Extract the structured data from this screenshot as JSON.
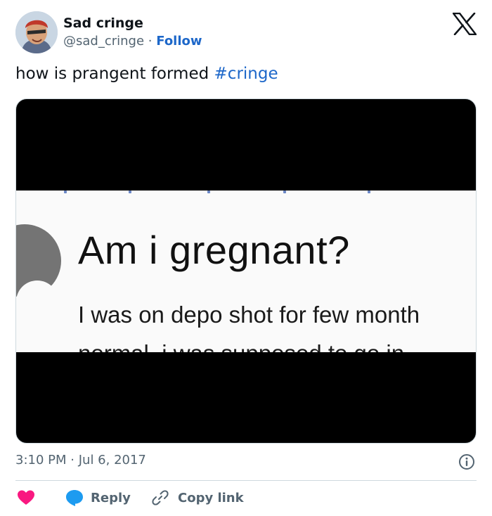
{
  "author": {
    "name": "Sad cringe",
    "handle": "@sad_cringe",
    "separator": "·",
    "follow_label": "Follow"
  },
  "tweet": {
    "text": "how is prangent formed ",
    "hashtag": "#cringe"
  },
  "media": {
    "heading": "Am i gregnant?",
    "body": "I was on depo shot for few month",
    "body_cut": "normal, i was supposed to go in"
  },
  "meta": {
    "time": "3:10 PM",
    "separator": "·",
    "date": "Jul 6, 2017"
  },
  "actions": {
    "reply_label": "Reply",
    "copy_link_label": "Copy link"
  },
  "colors": {
    "accent": "#1d67c9",
    "like": "#f91880",
    "reply_bubble": "#1d9bf0",
    "muted": "#536471"
  },
  "icons": [
    "x-logo-icon",
    "info-icon",
    "heart-icon",
    "reply-bubble-icon",
    "link-icon"
  ]
}
